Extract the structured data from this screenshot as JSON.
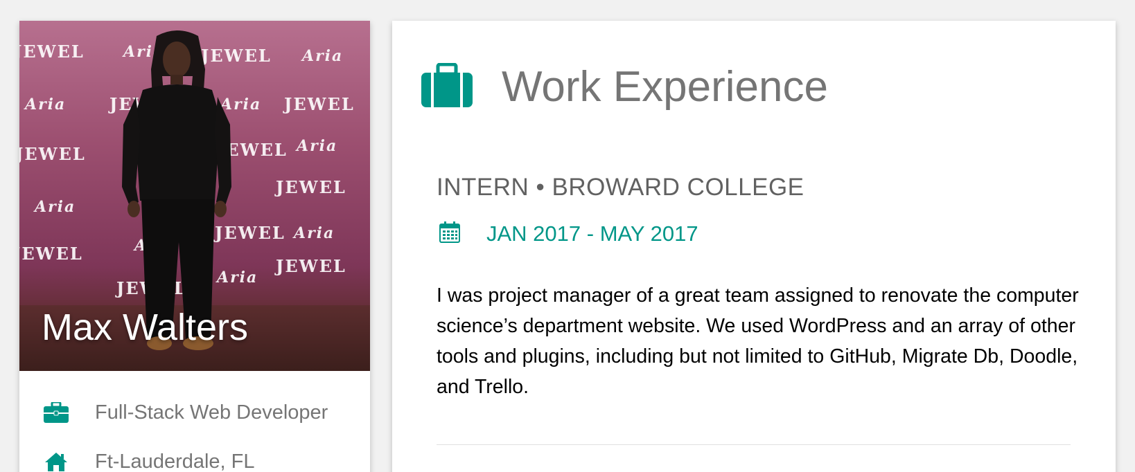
{
  "profile": {
    "name": "Max Walters",
    "info": [
      {
        "icon": "briefcase-icon",
        "text": "Full-Stack Web Developer"
      },
      {
        "icon": "home-icon",
        "text": "Ft-Lauderdale, FL"
      }
    ],
    "photo_logos": {
      "jewel": "JEWEL",
      "aria": "Aria"
    }
  },
  "work": {
    "title": "Work Experience",
    "jobs": [
      {
        "title": "INTERN • BROWARD COLLEGE",
        "dates": "JAN 2017 - MAY 2017",
        "description": "I was project manager of a great team assigned to renovate the computer science’s department website. We used WordPress and an array of other tools and plugins, including but not limited to GitHub, Migrate Db, Doodle, and Trello."
      }
    ]
  },
  "colors": {
    "accent": "#009688",
    "heading_gray": "#757575",
    "background": "#f1f1f1"
  }
}
